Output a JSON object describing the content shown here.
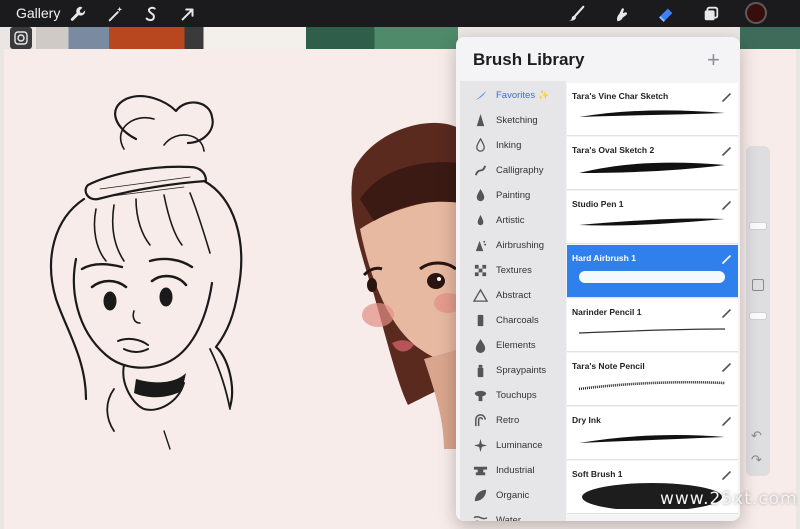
{
  "toolbar": {
    "gallery_label": "Gallery",
    "tools_left": [
      {
        "icon": "wrench-icon"
      },
      {
        "icon": "magic-wand-icon"
      },
      {
        "icon": "selection-icon"
      },
      {
        "icon": "transform-arrow-icon"
      }
    ],
    "tools_right": [
      {
        "icon": "brush-icon"
      },
      {
        "icon": "smudge-icon"
      },
      {
        "icon": "eraser-icon"
      },
      {
        "icon": "layers-icon"
      }
    ],
    "current_color": "#3a0d0d",
    "active_tool_color": "#3b82f6"
  },
  "brush_library": {
    "title": "Brush Library",
    "add_label": "+",
    "sets": [
      {
        "label": "Favorites",
        "icon": "favorites-stroke-icon",
        "active": true,
        "sparkle": "✨"
      },
      {
        "label": "Sketching",
        "icon": "pencil-tip-icon"
      },
      {
        "label": "Inking",
        "icon": "ink-drop-icon"
      },
      {
        "label": "Calligraphy",
        "icon": "calligraphy-icon"
      },
      {
        "label": "Painting",
        "icon": "paint-drop-icon"
      },
      {
        "label": "Artistic",
        "icon": "artistic-drop-icon"
      },
      {
        "label": "Airbrushing",
        "icon": "airbrush-icon"
      },
      {
        "label": "Textures",
        "icon": "checker-icon"
      },
      {
        "label": "Abstract",
        "icon": "triangle-icon"
      },
      {
        "label": "Charcoals",
        "icon": "charcoal-icon"
      },
      {
        "label": "Elements",
        "icon": "elements-icon"
      },
      {
        "label": "Spraypaints",
        "icon": "spray-can-icon"
      },
      {
        "label": "Touchups",
        "icon": "touchup-icon"
      },
      {
        "label": "Retro",
        "icon": "retro-icon"
      },
      {
        "label": "Luminance",
        "icon": "sparkle-icon"
      },
      {
        "label": "Industrial",
        "icon": "anvil-icon"
      },
      {
        "label": "Organic",
        "icon": "leaf-icon"
      },
      {
        "label": "Water",
        "icon": "water-icon"
      }
    ],
    "brushes": [
      {
        "name": "Tara's Vine Char Sketch",
        "stroke": "taper"
      },
      {
        "name": "Tara's Oval Sketch 2",
        "stroke": "taper-thick"
      },
      {
        "name": "Studio Pen 1",
        "stroke": "pen"
      },
      {
        "name": "Hard Airbrush 1",
        "stroke": "airbrush",
        "selected": true
      },
      {
        "name": "Narinder Pencil 1",
        "stroke": "pencil"
      },
      {
        "name": "Tara's Note Pencil",
        "stroke": "note-pencil"
      },
      {
        "name": "Dry Ink",
        "stroke": "dry-ink"
      },
      {
        "name": "Soft Brush 1",
        "stroke": "soft"
      }
    ],
    "selection_color": "#2f80ed"
  },
  "watermark": "www.25xt.com"
}
